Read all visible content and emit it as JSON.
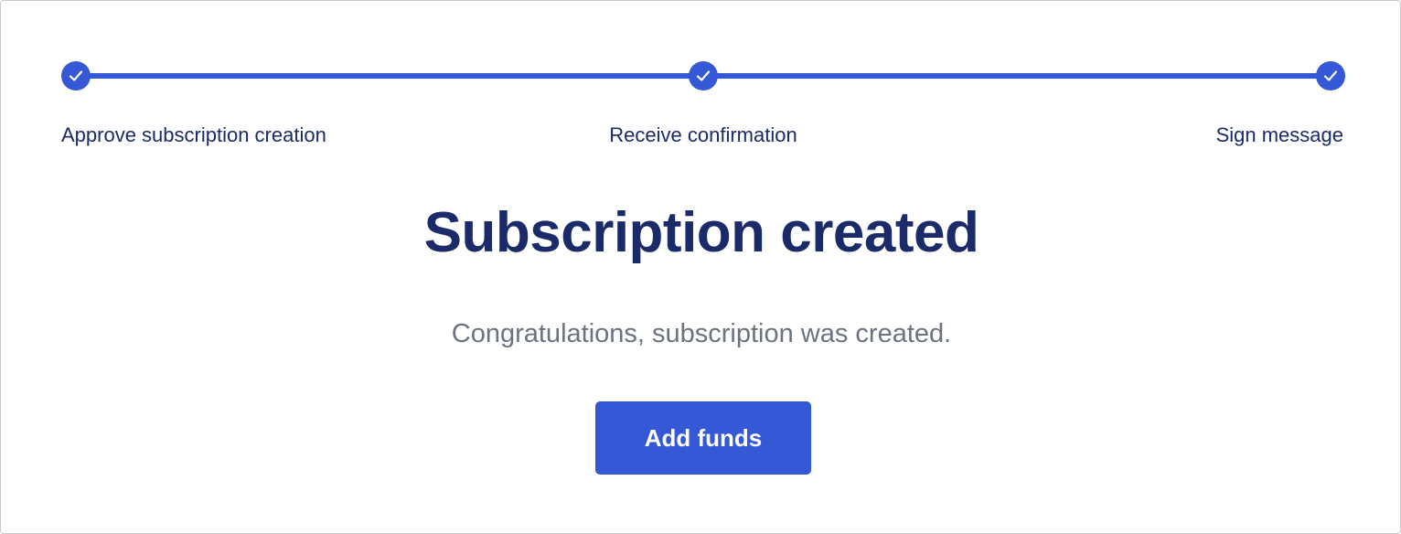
{
  "stepper": {
    "steps": [
      {
        "label": "Approve subscription creation",
        "status": "completed",
        "icon": "check-icon"
      },
      {
        "label": "Receive confirmation",
        "status": "completed",
        "icon": "check-icon"
      },
      {
        "label": "Sign message",
        "status": "completed",
        "icon": "check-icon"
      }
    ]
  },
  "main": {
    "title": "Subscription created",
    "message": "Congratulations, subscription was created.",
    "add_funds_label": "Add funds"
  },
  "colors": {
    "accent": "#3558d6",
    "heading": "#1b2a68",
    "muted_text": "#6b7280",
    "background": "#ffffff"
  }
}
